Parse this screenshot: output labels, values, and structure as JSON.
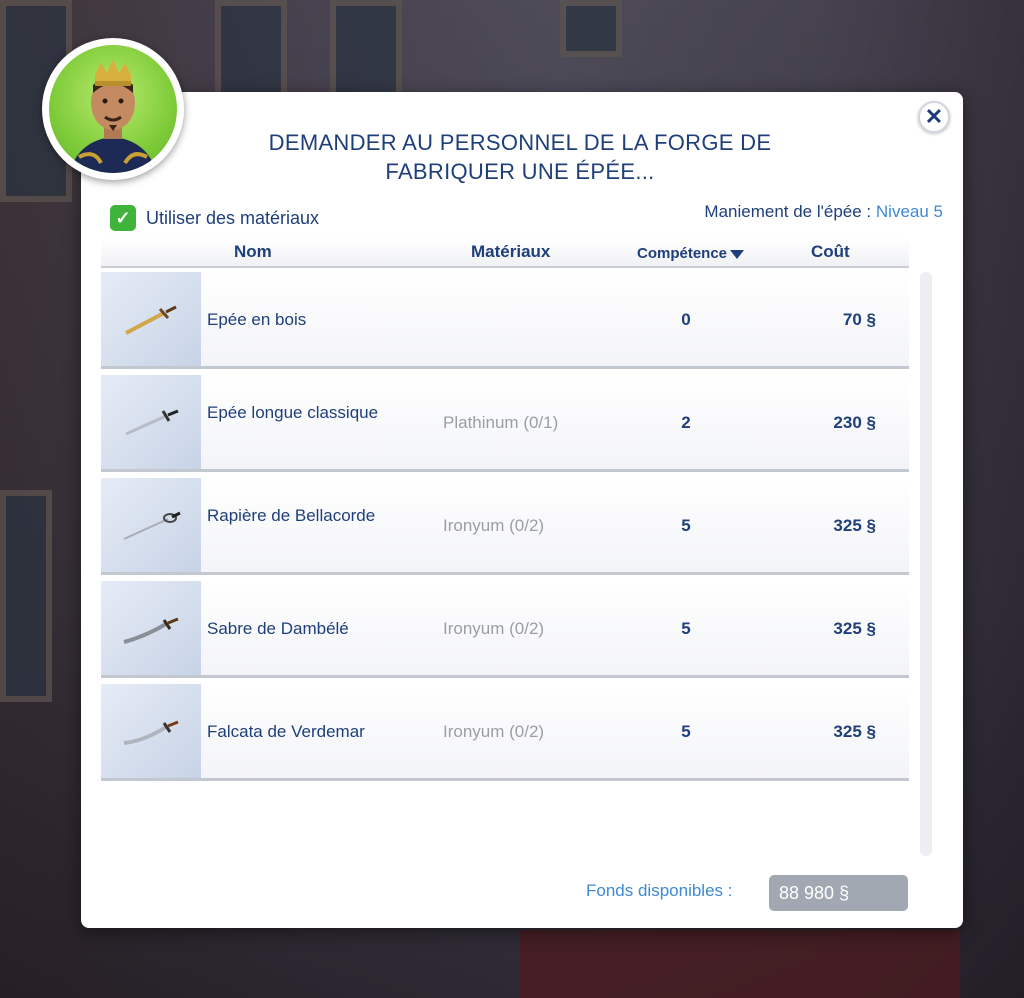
{
  "dialog": {
    "title": "Demander au personnel de la forge de fabriquer une épée...",
    "close_icon": "close-icon"
  },
  "options": {
    "use_materials_label": "Utiliser des matériaux",
    "use_materials_checked": true,
    "skill_label": "Maniement de l'épée  :",
    "skill_value": "Niveau 5"
  },
  "table": {
    "headers": {
      "name": "Nom",
      "materials": "Matériaux",
      "skill": "Compétence",
      "cost": "Coût"
    },
    "sort_icon": "sort-down-icon",
    "rows": [
      {
        "name": "Epée en bois",
        "materials": "",
        "skill": "0",
        "cost": "70"
      },
      {
        "name": "Epée longue classique",
        "materials": "Plathinum (0/1)",
        "skill": "2",
        "cost": "230"
      },
      {
        "name": "Rapière de Bellacorde",
        "materials": "Ironyum (0/2)",
        "skill": "5",
        "cost": "325"
      },
      {
        "name": "Sabre de Dambélé",
        "materials": "Ironyum (0/2)",
        "skill": "5",
        "cost": "325"
      },
      {
        "name": "Falcata de Verdemar",
        "materials": "Ironyum (0/2)",
        "skill": "5",
        "cost": "325"
      }
    ],
    "currency_symbol": "§"
  },
  "footer": {
    "funds_label": "Fonds disponibles  :",
    "funds_value": "88 980"
  },
  "colors": {
    "title": "#1f3f7a",
    "accent": "#3d8ad6",
    "checkbox": "#3fb33a",
    "disabled_text": "#9a9ea7"
  }
}
